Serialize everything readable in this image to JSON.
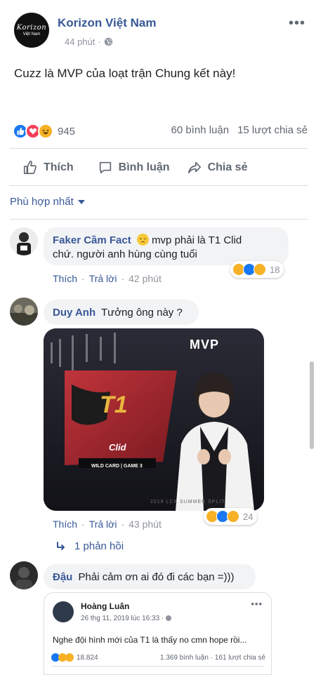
{
  "post": {
    "page_name": "Korizon Việt Nam",
    "avatar_line1": "Korizon",
    "avatar_line2": "Việt Nam",
    "time": "44 phút",
    "dot": "·",
    "text": "Cuzz là MVP của loạt trận Chung kết này!",
    "reaction_count": "945",
    "comments_count": "60 bình luận",
    "shares_count": "15 lượt chia sẻ"
  },
  "actions": {
    "like": "Thích",
    "comment": "Bình luận",
    "share": "Chia sẻ"
  },
  "sort": {
    "label": "Phù hợp nhất"
  },
  "comments": [
    {
      "author": "Faker Cầm Fact",
      "text_line1": "mvp phải là T1 Clid",
      "text_line2": "chứ. người anh hùng cùng tuổi",
      "like": "Thích",
      "reply": "Trả lời",
      "time": "42 phút",
      "reactions": "18"
    },
    {
      "author": "Duy Anh",
      "text": "Tưởng ông này ?",
      "image_title": "MVP",
      "image_logo": "T1",
      "image_player": "Clid",
      "image_caption": "WILD CARD | GAME 3",
      "image_footer": "2019 LCK SUMMER SPLIT",
      "like": "Thích",
      "reply": "Trả lời",
      "time": "43 phút",
      "reactions": "24",
      "replies_link": "1 phản hồi"
    },
    {
      "author": "Đậu",
      "text": "Phải cảm ơn ai đó đi các bạn =)))",
      "embed": {
        "name": "Hoàng Luân",
        "meta": "26 thg 11, 2019 lúc 16:33 ·",
        "text": "Nghe đội hình mới của T1 là thấy no cmn hope rồi...",
        "reactions": "18.824",
        "stats": "1.369 bình luận · 161 lượt chia sẻ"
      }
    }
  ],
  "colors": {
    "link": "#385898",
    "like_blue": "#1877f2",
    "love_red": "#f33e58",
    "haha_yellow": "#f7b125"
  }
}
